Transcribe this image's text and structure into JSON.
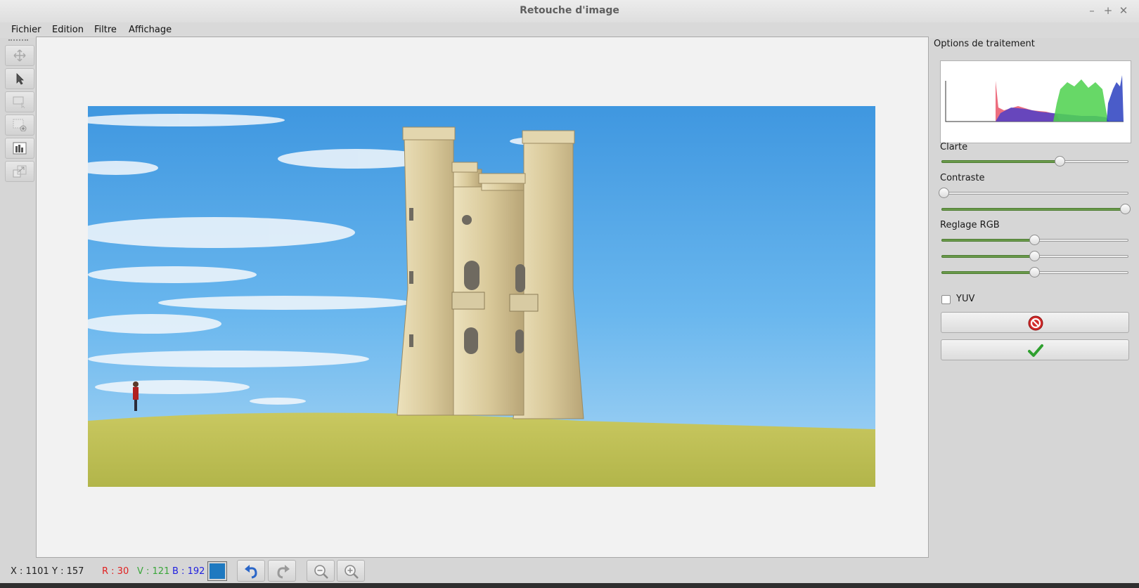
{
  "window": {
    "title": "Retouche d'image",
    "controls": [
      "–",
      "+",
      "✕"
    ]
  },
  "menu": {
    "file": "Fichier",
    "edit": "Edition",
    "filter": "Filtre",
    "view": "Affichage"
  },
  "tools": [
    {
      "name": "move-tool",
      "icon": "move-icon"
    },
    {
      "name": "select-tool",
      "icon": "pointer-icon"
    },
    {
      "name": "selection-rect-tool",
      "icon": "selection-rect-icon"
    },
    {
      "name": "add-layer-tool",
      "icon": "layer-add-icon"
    },
    {
      "name": "histogram-tool",
      "icon": "histogram-icon"
    },
    {
      "name": "resize-tool",
      "icon": "resize-icon"
    }
  ],
  "panel": {
    "title": "Options de traitement",
    "brightness_label": "Clarte",
    "brightness": 0.64,
    "contrast_label": "Contraste",
    "contrast_low": 0.0,
    "contrast_high": 1.0,
    "rgb_label": "Reglage RGB",
    "rgb_r": 0.5,
    "rgb_g": 0.5,
    "rgb_b": 0.5,
    "yuv_label": "YUV",
    "yuv_checked": false,
    "cancel_icon": "cancel-icon",
    "apply_icon": "check-icon"
  },
  "status": {
    "x": "X : 1101",
    "y": "Y : 157",
    "r": "R : 30",
    "g": "V : 121",
    "b": "B : 192",
    "r_color": "#e02020",
    "g_color": "#3aa63a",
    "b_color": "#2020e0",
    "swatch_color": "#1e79c0"
  },
  "colors": {
    "accent_slider": "#6a9a4a",
    "sky": "#5aaae8"
  }
}
